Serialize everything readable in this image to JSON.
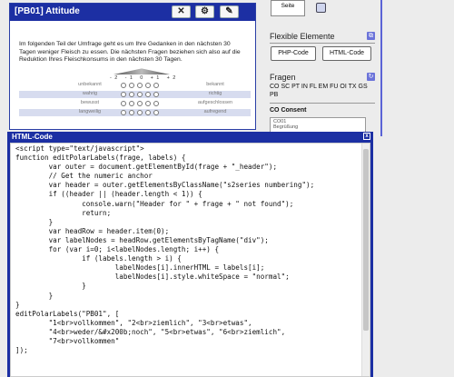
{
  "question": {
    "title": "[PB01] Attitude",
    "buttons": [
      "✕",
      "⚙",
      "✎"
    ],
    "text": "Im folgenden Teil der Umfrage geht es um Ihre Gedanken in den nächsten 30 Tagen weniger Fleisch zu essen. Die nächsten Fragen beziehen sich also auf die Reduktion Ihres Fleischkonsums in den nächsten 30 Tagen.",
    "scale_numbers": "-2 -1 0 +1 +2",
    "rows": [
      {
        "left": "unbekannt",
        "right": "bekannt"
      },
      {
        "left": "wahrig",
        "right": "richtig"
      },
      {
        "left": "bewusst",
        "right": "aufgeschlossen"
      },
      {
        "left": "langweilig",
        "right": "aufregend"
      }
    ]
  },
  "sidebar": {
    "seite_label": "Seite",
    "flexible_title": "Flexible Elemente",
    "php_label": "PHP-Code",
    "html_label": "HTML-Code",
    "fragen_title": "Fragen",
    "fragen_codes": "CO SC PT IN FL EM FU OI TX GS PB",
    "co_title": "CO Consent",
    "co_item1": "CO01",
    "co_item2": "Begrüßung"
  },
  "dialog": {
    "title": "HTML-Code",
    "close": "x"
  },
  "code_lines": [
    "<script type=\"text/javascript\">",
    "function editPolarLabels(frage, labels) {",
    "        var outer = document.getElementById(frage + \"_header\");",
    "        // Get the numeric anchor",
    "        var header = outer.getElementsByClassName(\"s2series numbering\");",
    "        if ((header || (header.length < 1)) {",
    "                console.warn(\"Header for \" + frage + \" not found\");",
    "                return;",
    "        }",
    "        var headRow = header.item(0);",
    "        var labelNodes = headRow.getElementsByTagName(\"div\");",
    "        for (var i=0; i<labelNodes.length; i++) {",
    "                if (labels.length > i) {",
    "                        labelNodes[i].innerHTML = labels[i];",
    "                        labelNodes[i].style.whiteSpace = \"normal\";",
    "                }",
    "        }",
    "}",
    "editPolarLabels(\"PB01\", [",
    "        \"1<br>vollkommen\", \"2<br>ziemlich\", \"3<br>etwas\",",
    "        \"4<br>weder/&#x200b;noch\", \"5<br>etwas\", \"6<br>ziemlich\",",
    "        \"7<br>vollkommen\"",
    "]);"
  ]
}
